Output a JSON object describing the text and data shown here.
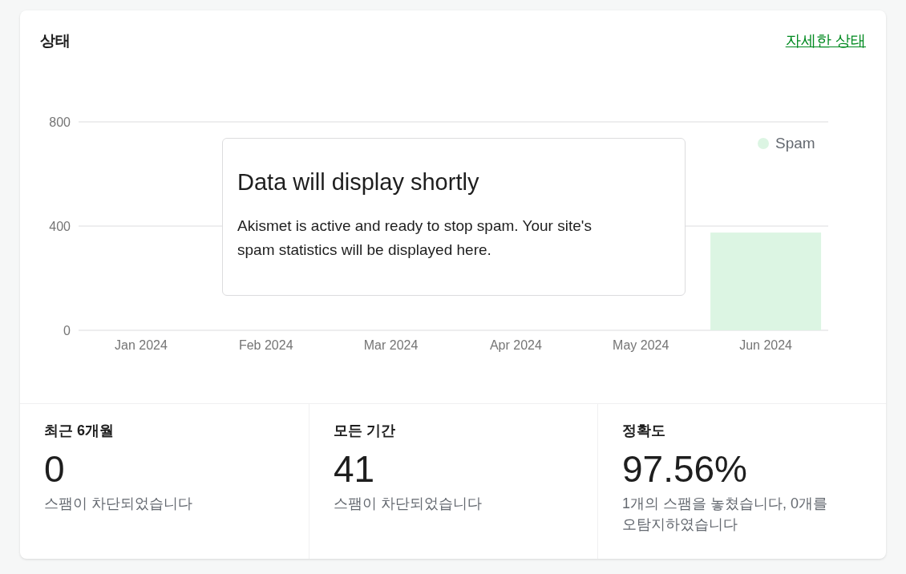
{
  "header": {
    "title": "상태",
    "link": "자세한 상태"
  },
  "chart": {
    "chart_data": {
      "type": "bar",
      "categories": [
        "Jan 2024",
        "Feb 2024",
        "Mar 2024",
        "Apr 2024",
        "May 2024",
        "Jun 2024"
      ],
      "series": [
        {
          "name": "Spam",
          "color": "#dcf5e3",
          "values": [
            0,
            0,
            0,
            0,
            0,
            375
          ]
        }
      ],
      "ylim": [
        0,
        800
      ],
      "yticks": [
        0,
        400,
        800
      ]
    },
    "notice": {
      "title": "Data will display shortly",
      "text": "Akismet is active and ready to stop spam. Your site's spam statistics will be displayed here."
    }
  },
  "stats": [
    {
      "label": "최근 6개월",
      "value": "0",
      "description": "스팸이 차단되었습니다"
    },
    {
      "label": "모든 기간",
      "value": "41",
      "description": "스팸이 차단되었습니다"
    },
    {
      "label": "정확도",
      "value": "97.56%",
      "description": "1개의 스팸을 놓쳤습니다, 0개를 오탐지하였습니다"
    }
  ]
}
